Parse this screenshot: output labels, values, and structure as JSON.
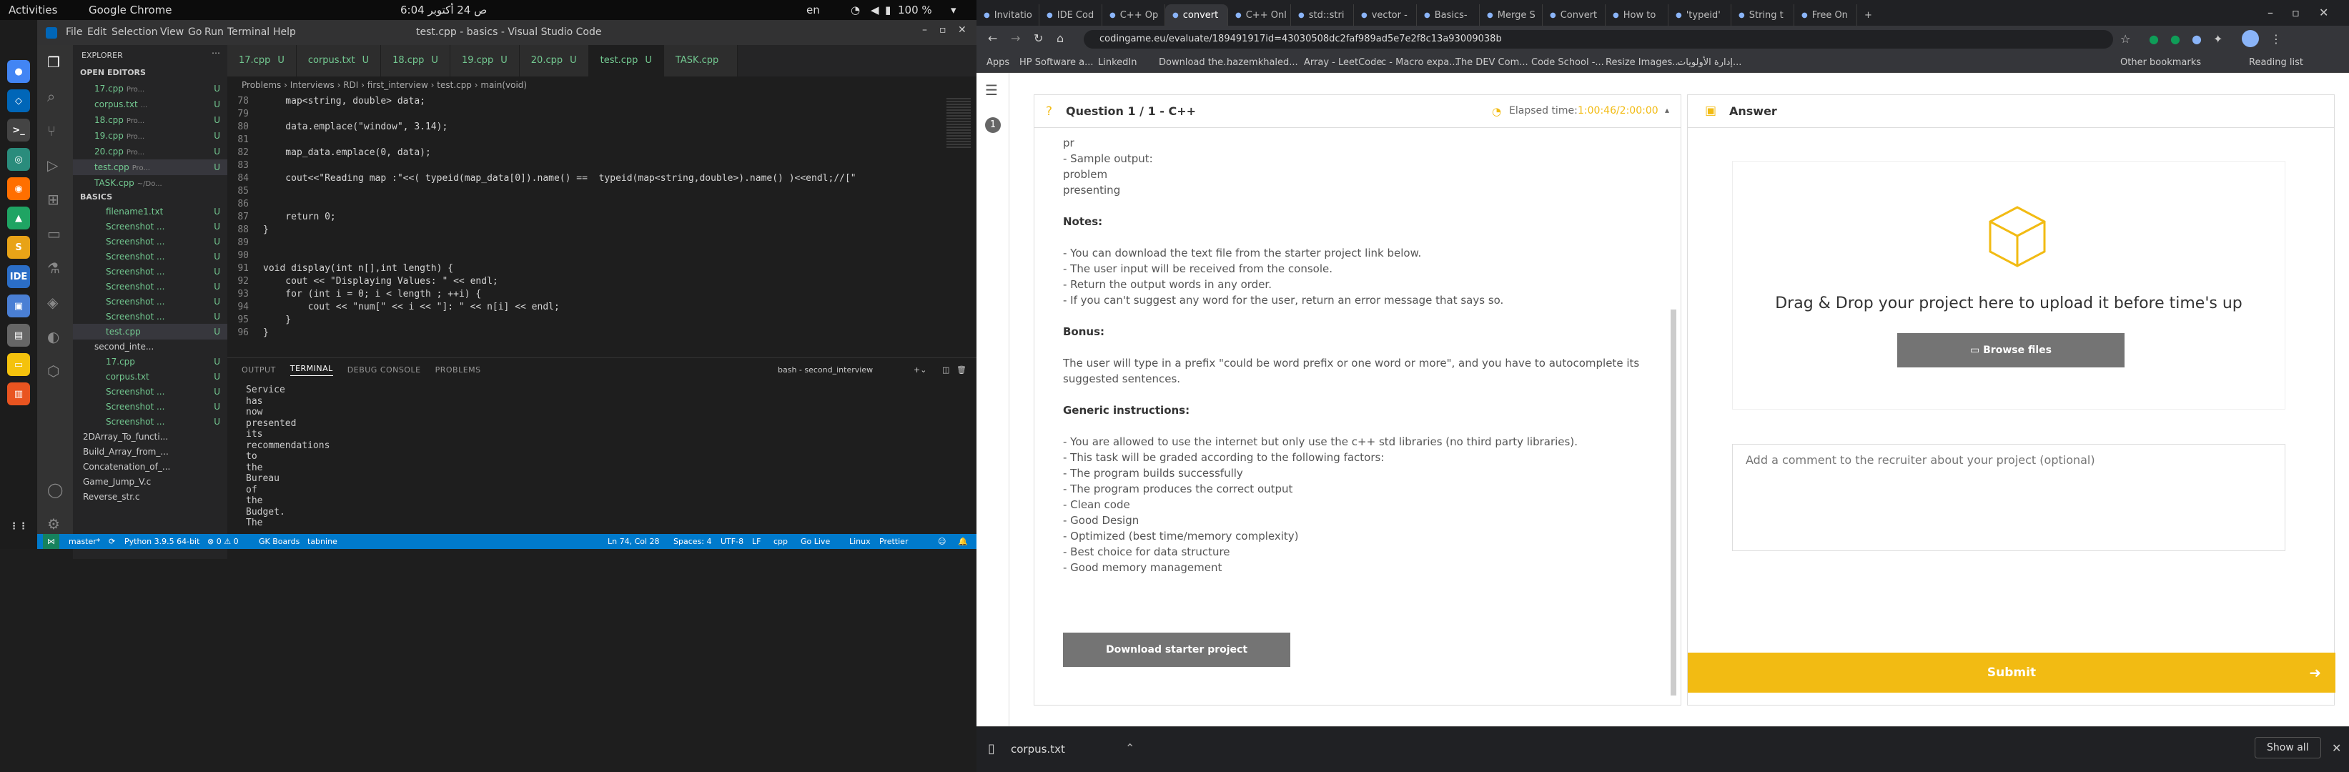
{
  "topbar": {
    "activities": "Activities",
    "app": "Google Chrome",
    "datetime": "6:04 ص  24 أكتوبر",
    "lang": "en",
    "battery": "100 %"
  },
  "vscode": {
    "menu": [
      "File",
      "Edit",
      "Selection",
      "View",
      "Go",
      "Run",
      "Terminal",
      "Help"
    ],
    "title": "test.cpp - basics - Visual Studio Code",
    "explorer_title": "EXPLORER",
    "open_editors_label": "OPEN EDITORS",
    "open_editors": [
      {
        "name": "17.cpp",
        "hint": "Pro...",
        "mark": "U"
      },
      {
        "name": "corpus.txt",
        "hint": "...",
        "mark": "U"
      },
      {
        "name": "18.cpp",
        "hint": "Pro...",
        "mark": "U"
      },
      {
        "name": "19.cpp",
        "hint": "Pro...",
        "mark": "U"
      },
      {
        "name": "20.cpp",
        "hint": "Pro...",
        "mark": "U"
      },
      {
        "name": "test.cpp",
        "hint": "Pro...",
        "mark": "U"
      },
      {
        "name": "TASK.cpp",
        "hint": "~/Do...",
        "mark": ""
      }
    ],
    "workspace_label": "BASICS",
    "workspace_items": [
      {
        "name": "filename1.txt",
        "mark": "U"
      },
      {
        "name": "Screenshot ...",
        "mark": "U"
      },
      {
        "name": "Screenshot ...",
        "mark": "U"
      },
      {
        "name": "Screenshot ...",
        "mark": "U"
      },
      {
        "name": "Screenshot ...",
        "mark": "U"
      },
      {
        "name": "Screenshot ...",
        "mark": "U"
      },
      {
        "name": "Screenshot ...",
        "mark": "U"
      },
      {
        "name": "Screenshot ...",
        "mark": "U"
      },
      {
        "name": "test.cpp",
        "mark": "U"
      },
      {
        "name": "second_inte...",
        "mark": ""
      },
      {
        "name": "17.cpp",
        "mark": "U"
      },
      {
        "name": "corpus.txt",
        "mark": "U"
      },
      {
        "name": "Screenshot ...",
        "mark": "U"
      },
      {
        "name": "Screenshot ...",
        "mark": "U"
      },
      {
        "name": "Screenshot ...",
        "mark": "U"
      },
      {
        "name": "2DArray_To_functi...",
        "mark": ""
      },
      {
        "name": "Build_Array_from_...",
        "mark": ""
      },
      {
        "name": "Concatenation_of_...",
        "mark": ""
      },
      {
        "name": "Game_Jump_V.c",
        "mark": ""
      },
      {
        "name": "Reverse_str.c",
        "mark": ""
      }
    ],
    "tabs": [
      {
        "label": "17.cpp",
        "mark": "U"
      },
      {
        "label": "corpus.txt",
        "mark": "U"
      },
      {
        "label": "18.cpp",
        "mark": "U"
      },
      {
        "label": "19.cpp",
        "mark": "U"
      },
      {
        "label": "20.cpp",
        "mark": "U"
      },
      {
        "label": "test.cpp",
        "mark": "U"
      },
      {
        "label": "TASK.cpp",
        "mark": ""
      }
    ],
    "breadcrumb": "Problems › Interviews › RDI › first_interview › test.cpp › main(void)",
    "code": [
      {
        "n": "78",
        "t": "    map<string, double> data;"
      },
      {
        "n": "79",
        "t": ""
      },
      {
        "n": "80",
        "t": "    data.emplace(\"window\", 3.14);"
      },
      {
        "n": "81",
        "t": ""
      },
      {
        "n": "82",
        "t": "    map_data.emplace(0, data);"
      },
      {
        "n": "83",
        "t": ""
      },
      {
        "n": "84",
        "t": "    cout<<\"Reading map :\"<<( typeid(map_data[0]).name() ==  typeid(map<string,double>).name() )<<endl;//[\""
      },
      {
        "n": "85",
        "t": ""
      },
      {
        "n": "86",
        "t": ""
      },
      {
        "n": "87",
        "t": "    return 0;"
      },
      {
        "n": "88",
        "t": "}"
      },
      {
        "n": "89",
        "t": ""
      },
      {
        "n": "90",
        "t": ""
      },
      {
        "n": "91",
        "t": "void display(int n[],int length) {"
      },
      {
        "n": "92",
        "t": "    cout << \"Displaying Values: \" << endl;"
      },
      {
        "n": "93",
        "t": "    for (int i = 0; i < length ; ++i) {"
      },
      {
        "n": "94",
        "t": "        cout << \"num[\" << i << \"]: \" << n[i] << endl;"
      },
      {
        "n": "95",
        "t": "    }"
      },
      {
        "n": "96",
        "t": "}"
      }
    ],
    "panel_tabs": [
      "OUTPUT",
      "TERMINAL",
      "DEBUG CONSOLE",
      "PROBLEMS"
    ],
    "terminal_name": "bash - second_interview",
    "terminal_lines": [
      "Service",
      "has",
      "now",
      "presented",
      "its",
      "recommendations",
      "to",
      "the",
      "Bureau",
      "of",
      "the",
      "Budget.",
      "The"
    ],
    "status": {
      "branch": "master*",
      "python": "Python 3.9.5 64-bit",
      "problems": "⊗ 0 ⚠ 0",
      "gk": "GK Boards",
      "tabnine": "tabnine",
      "position": "Ln 74, Col 28",
      "spaces": "Spaces: 4",
      "encoding": "UTF-8",
      "eol": "LF",
      "lang": "cpp",
      "golive": "Go Live",
      "os": "Linux",
      "prettier": "Prettier"
    }
  },
  "chrome": {
    "tabs": [
      "Invitatio",
      "IDE Cod",
      "C++ Op",
      "convert",
      "C++ Onl",
      "std::stri",
      "vector -",
      "Basics-",
      "Merge S",
      "Convert",
      "How to",
      "'typeid'",
      "String t",
      "Free On"
    ],
    "url": "codingame.eu/evaluate/189491917id=43030508dc2faf989ad5e7e2f8c13a93009038b",
    "bookmarks": [
      "Apps",
      "HP Software a...",
      "LinkedIn",
      "Download the...",
      "hazemkhaled...",
      "Array - LeetCode",
      "c - Macro expa...",
      "The DEV Com...",
      "Code School -...",
      "Resize Images...",
      "إدارة الأولويات...",
      "Other bookmarks",
      "Reading list"
    ],
    "question_title": "Question 1 / 1 - C++",
    "elapsed_label": "Elapsed time:",
    "elapsed_value": "1:00:46/2:00:00",
    "answer_title": "Answer",
    "upload_text": "Drag & Drop your project here to upload it before time's up",
    "browse_label": "Browse files",
    "comment_placeholder": "Add a comment to the recruiter about your project (optional)",
    "submit_label": "Submit",
    "download_btn": "Download starter project",
    "download_file": "corpus.txt",
    "show_all": "Show all",
    "question_lines": [
      {
        "t": "pr",
        "h": false
      },
      {
        "t": "- Sample output:",
        "h": false
      },
      {
        "t": "problem",
        "h": false
      },
      {
        "t": "presenting",
        "h": false
      },
      {
        "t": "",
        "h": false
      },
      {
        "t": "Notes:",
        "h": true
      },
      {
        "t": "",
        "h": false
      },
      {
        "t": "- You can download the text file from the starter project link below.",
        "h": false
      },
      {
        "t": "- The user input will be received from the console.",
        "h": false
      },
      {
        "t": "- Return the output words in any order.",
        "h": false
      },
      {
        "t": "- If you can't suggest any word for the user, return an error message that says so.",
        "h": false
      },
      {
        "t": "",
        "h": false
      },
      {
        "t": "Bonus:",
        "h": true
      },
      {
        "t": "",
        "h": false
      },
      {
        "t": "The user will type in a prefix \"could be word prefix or one word or more\", and you have to autocomplete its",
        "h": false
      },
      {
        "t": "suggested sentences.",
        "h": false
      },
      {
        "t": "",
        "h": false
      },
      {
        "t": "Generic instructions:",
        "h": true
      },
      {
        "t": "",
        "h": false
      },
      {
        "t": "- You are allowed to use the internet but only use the c++ std libraries (no third party libraries).",
        "h": false
      },
      {
        "t": "- This task will be graded according to the following factors:",
        "h": false
      },
      {
        "t": "- The program builds successfully",
        "h": false
      },
      {
        "t": "- The program produces the correct output",
        "h": false
      },
      {
        "t": "- Clean code",
        "h": false
      },
      {
        "t": "- Good Design",
        "h": false
      },
      {
        "t": "- Optimized (best time/memory complexity)",
        "h": false
      },
      {
        "t": "- Best choice for data structure",
        "h": false
      },
      {
        "t": "- Good memory management",
        "h": false
      }
    ],
    "question_number": "1"
  }
}
